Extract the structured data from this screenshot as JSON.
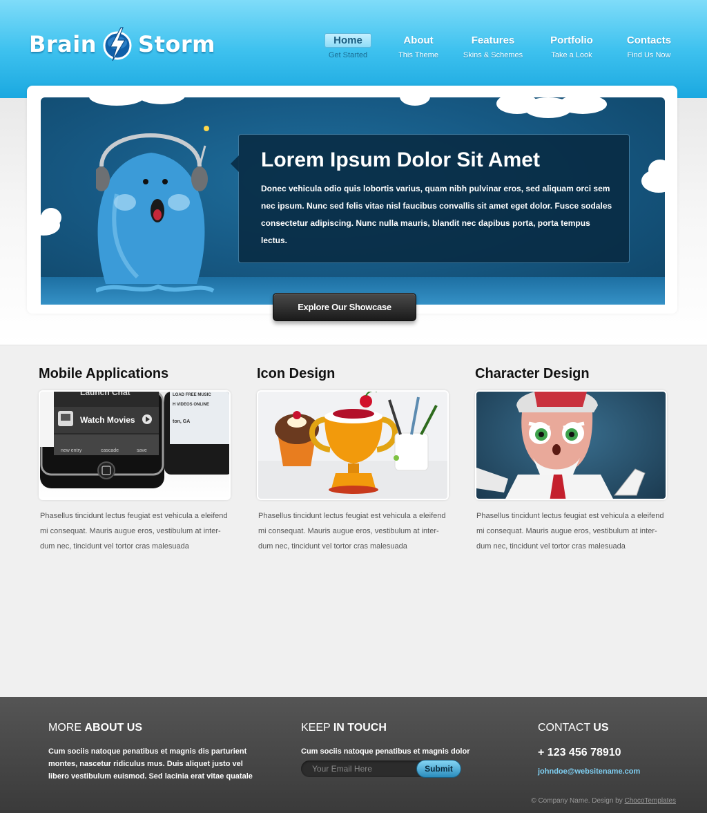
{
  "brand": {
    "name_left": "Brain",
    "name_right": "Storm"
  },
  "nav": [
    {
      "label": "Home",
      "sub": "Get Started",
      "active": true
    },
    {
      "label": "About",
      "sub": "This Theme",
      "active": false
    },
    {
      "label": "Features",
      "sub": "Skins & Schemes",
      "active": false
    },
    {
      "label": "Portfolio",
      "sub": "Take a Look",
      "active": false
    },
    {
      "label": "Contacts",
      "sub": "Find Us Now",
      "active": false
    }
  ],
  "hero": {
    "title": "Lorem Ipsum Dolor Sit Amet",
    "body": "Donec vehicula odio quis lobortis varius, quam nibh pulvinar eros, sed aliquam orci sem nec ipsum. Nunc sed felis vitae nisl faucibus convallis sit amet eget dolor. Fusce sodales consectetur adipiscing. Nunc nulla mauris, blandit nec dapibus porta, porta tempus lectus.",
    "cta": "Explore Our Showcase"
  },
  "features": [
    {
      "title": "Mobile Applications",
      "text": "Phasellus tincidunt lectus feugiat est vehicula a eleifend mi consequat. Mauris augue eros, vestibulum at inter-dum nec, tincidunt vel tortor cras malesuada",
      "phone": {
        "row1": "Launch Chat",
        "row2": "Watch Movies",
        "row3a": "new entry",
        "row3b": "cascade",
        "row3c": "save",
        "side1": "LOAD FREE MUSIC",
        "side2": "H VIDEOS ONLINE",
        "side3": "ton, GA"
      }
    },
    {
      "title": "Icon Design",
      "text": "Phasellus tincidunt lectus feugiat est vehicula a eleifend mi consequat. Mauris augue eros, vestibulum at inter-dum nec, tincidunt vel tortor cras malesuada"
    },
    {
      "title": "Character Design",
      "text": "Phasellus tincidunt lectus feugiat est vehicula a eleifend mi consequat. Mauris augue eros, vestibulum at inter-dum nec, tincidunt vel tortor cras malesuada"
    }
  ],
  "footer": {
    "about": {
      "title_light": "MORE ",
      "title_bold": "ABOUT US",
      "text": "Cum sociis natoque penatibus et magnis dis parturient montes, nascetur ridiculus mus. Duis aliquet justo vel libero vestibulum euismod. Sed lacinia erat vitae quatale"
    },
    "touch": {
      "title_light": "KEEP ",
      "title_bold": "IN TOUCH",
      "text": "Cum sociis natoque penatibus et magnis dolor",
      "email_placeholder": "Your Email Here",
      "submit": "Submit"
    },
    "contact": {
      "title_light": "CONTACT ",
      "title_bold": "US",
      "phone": "+ 123 456 78910",
      "email": "johndoe@websitename.com"
    },
    "copyright": "© Company Name. Design by ",
    "copyright_link": "ChocoTemplates"
  },
  "colors": {
    "header_top": "#7fdcf9",
    "header_bottom": "#1aa8e0",
    "hero_blue": "#175a85",
    "footer": "#3a3a3a",
    "accent": "#2a8cbd"
  }
}
